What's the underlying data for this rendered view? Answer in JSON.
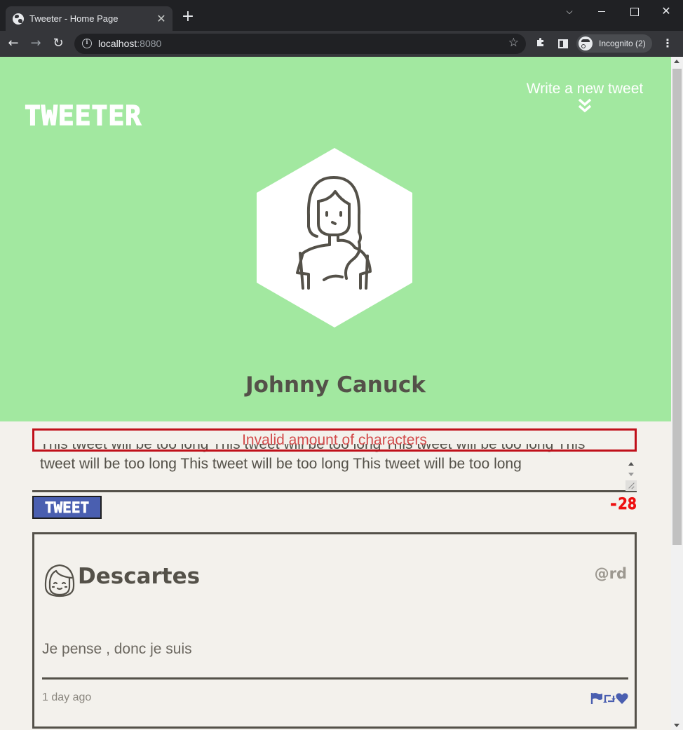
{
  "browser": {
    "tab_title": "Tweeter - Home Page",
    "url_host": "localhost",
    "url_port": ":8080",
    "incognito_label": "Incognito (2)"
  },
  "header": {
    "logo": "TWEETER",
    "write_tweet_label": "Write a new tweet",
    "user_name": "Johnny Canuck",
    "bg_color": "#a2e8a0"
  },
  "composer": {
    "error_message": "Invalid amount of characters",
    "text_value": "This tweet will be too long This tweet will be too long This tweet will be too long This tweet will be too long This tweet will be too long This tweet will be too long",
    "tweet_button_label": "TWEET",
    "char_counter": "-28",
    "error_color": "#c0101a",
    "counter_color": "#ee1111",
    "button_color": "#4a5fb0"
  },
  "tweets": [
    {
      "author": "Descartes",
      "handle": "@rd",
      "text": "Je pense , donc je suis",
      "timestamp": "1 day ago",
      "actions": [
        "flag-icon",
        "retweet-icon",
        "heart-icon"
      ]
    }
  ]
}
